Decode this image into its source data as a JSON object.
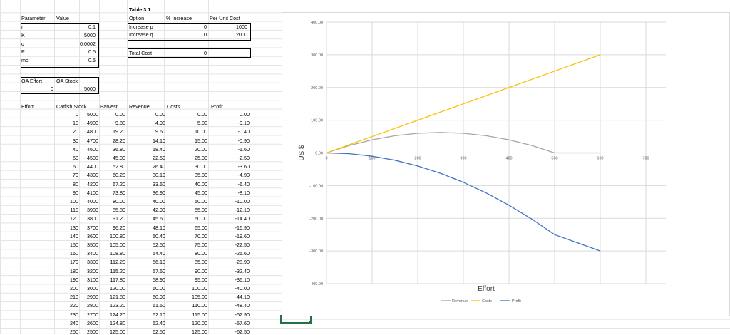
{
  "params": {
    "header_param": "Parameter",
    "header_value": "Value",
    "rows": [
      {
        "name": "r",
        "value": "0.1"
      },
      {
        "name": "K",
        "value": "5000"
      },
      {
        "name": "q",
        "value": "0.0002"
      },
      {
        "name": "P",
        "value": "0.5"
      },
      {
        "name": "mc",
        "value": "0.5"
      }
    ]
  },
  "table31": {
    "title": "Table 3.1",
    "col_option": "Option",
    "col_increase": "% Increase",
    "col_cost": "Per Unit Cost",
    "rows": [
      {
        "option": "Increase p",
        "increase": "0",
        "cost": "1000"
      },
      {
        "option": "Increase q",
        "increase": "0",
        "cost": "2000"
      }
    ],
    "total_label": "Total Cost",
    "total_value": "0"
  },
  "oa": {
    "effort_label": "OA Effort",
    "stock_label": "OA Stock",
    "effort_value": "0",
    "stock_value": "5000"
  },
  "main_table": {
    "headers": [
      "Effort",
      "Catfish Stock",
      "Harvest",
      "Revenue",
      "Costs",
      "Profit"
    ],
    "rows": [
      [
        "0",
        "5000",
        "0.00",
        "0.00",
        "0.00",
        "0.00"
      ],
      [
        "10",
        "4900",
        "9.80",
        "4.90",
        "5.00",
        "-0.10"
      ],
      [
        "20",
        "4800",
        "19.20",
        "9.60",
        "10.00",
        "-0.40"
      ],
      [
        "30",
        "4700",
        "28.20",
        "14.10",
        "15.00",
        "-0.90"
      ],
      [
        "40",
        "4600",
        "36.80",
        "18.40",
        "20.00",
        "-1.60"
      ],
      [
        "50",
        "4500",
        "45.00",
        "22.50",
        "25.00",
        "-2.50"
      ],
      [
        "60",
        "4400",
        "52.80",
        "26.40",
        "30.00",
        "-3.60"
      ],
      [
        "70",
        "4300",
        "60.20",
        "30.10",
        "35.00",
        "-4.90"
      ],
      [
        "80",
        "4200",
        "67.20",
        "33.60",
        "40.00",
        "-6.40"
      ],
      [
        "90",
        "4100",
        "73.80",
        "36.90",
        "45.00",
        "-8.10"
      ],
      [
        "100",
        "4000",
        "80.00",
        "40.00",
        "50.00",
        "-10.00"
      ],
      [
        "110",
        "3900",
        "85.80",
        "42.90",
        "55.00",
        "-12.10"
      ],
      [
        "120",
        "3800",
        "91.20",
        "45.60",
        "60.00",
        "-14.40"
      ],
      [
        "130",
        "3700",
        "96.20",
        "48.10",
        "65.00",
        "-16.90"
      ],
      [
        "140",
        "3600",
        "100.80",
        "50.40",
        "70.00",
        "-19.60"
      ],
      [
        "150",
        "3500",
        "105.00",
        "52.50",
        "75.00",
        "-22.50"
      ],
      [
        "160",
        "3400",
        "108.80",
        "54.40",
        "80.00",
        "-25.60"
      ],
      [
        "170",
        "3300",
        "112.20",
        "56.10",
        "85.00",
        "-28.90"
      ],
      [
        "180",
        "3200",
        "115.20",
        "57.60",
        "90.00",
        "-32.40"
      ],
      [
        "190",
        "3100",
        "117.80",
        "58.90",
        "95.00",
        "-36.10"
      ],
      [
        "200",
        "3000",
        "120.00",
        "60.00",
        "100.00",
        "-40.00"
      ],
      [
        "210",
        "2900",
        "121.80",
        "60.90",
        "105.00",
        "-44.10"
      ],
      [
        "220",
        "2800",
        "123.20",
        "61.60",
        "110.00",
        "-48.40"
      ],
      [
        "230",
        "2700",
        "124.20",
        "62.10",
        "115.00",
        "-52.90"
      ],
      [
        "240",
        "2600",
        "124.80",
        "62.40",
        "120.00",
        "-57.60"
      ],
      [
        "250",
        "2500",
        "125.00",
        "62.50",
        "125.00",
        "-62.50"
      ]
    ]
  },
  "chart_data": {
    "type": "line",
    "xlabel": "Effort",
    "ylabel": "US $",
    "xlim": [
      0,
      700
    ],
    "ylim": [
      -400,
      400
    ],
    "xticks": [
      "0",
      "100",
      "200",
      "300",
      "400",
      "500",
      "600",
      "700"
    ],
    "yticks": [
      "400.00",
      "300.00",
      "200.00",
      "100.00",
      "0.00",
      "-100.00",
      "-200.00",
      "-300.00",
      "-400.00"
    ],
    "grid": true,
    "legend_position": "bottom-right",
    "series": [
      {
        "name": "Revenue",
        "color": "#a5a5a5",
        "x": [
          0,
          50,
          100,
          150,
          200,
          250,
          300,
          350,
          400,
          450,
          500,
          550,
          600
        ],
        "y": [
          0,
          22.5,
          40,
          52.5,
          60,
          62.5,
          60,
          52.5,
          40,
          22.5,
          0,
          0,
          0
        ]
      },
      {
        "name": "Costs",
        "color": "#ffc000",
        "x": [
          0,
          100,
          200,
          300,
          400,
          500,
          600
        ],
        "y": [
          0,
          50,
          100,
          150,
          200,
          250,
          300
        ]
      },
      {
        "name": "Profit",
        "color": "#4472c4",
        "x": [
          0,
          50,
          100,
          150,
          200,
          250,
          300,
          350,
          400,
          450,
          500,
          550,
          600
        ],
        "y": [
          0,
          -2.5,
          -10,
          -22.5,
          -40,
          -62.5,
          -90,
          -122.5,
          -160,
          -202.5,
          -250,
          -275,
          -300
        ]
      }
    ]
  }
}
